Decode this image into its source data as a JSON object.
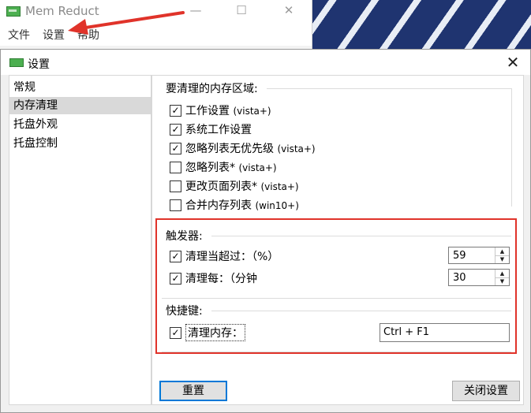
{
  "main_window": {
    "title": "Mem Reduct",
    "controls": {
      "minimize": "—",
      "maximize": "☐",
      "close": "✕"
    },
    "menu": [
      "文件",
      "设置",
      "帮助"
    ]
  },
  "dialog": {
    "title": "设置",
    "close": "✕",
    "nav": [
      "常规",
      "内存清理",
      "托盘外观",
      "托盘控制"
    ],
    "selected_nav": "内存清理",
    "regions": {
      "title": "要清理的内存区域:",
      "items": [
        {
          "label": "工作设置",
          "suffix": "(vista+)",
          "checked": true
        },
        {
          "label": "系统工作设置",
          "suffix": "",
          "checked": true
        },
        {
          "label": "忽略列表无优先级",
          "suffix": "(vista+)",
          "checked": true
        },
        {
          "label": "忽略列表*",
          "suffix": "(vista+)",
          "checked": false
        },
        {
          "label": "更改页面列表*",
          "suffix": "(vista+)",
          "checked": false
        },
        {
          "label": "合并内存列表",
          "suffix": "(win10+)",
          "checked": false
        }
      ]
    },
    "triggers": {
      "title": "触发器:",
      "threshold": {
        "label": "清理当超过：（%）",
        "checked": true,
        "value": "59"
      },
      "interval": {
        "label": "清理每：（分钟",
        "checked": true,
        "value": "30"
      }
    },
    "hotkeys": {
      "title": "快捷键:",
      "clean": {
        "label": "清理内存：",
        "checked": true,
        "value": "Ctrl + F1"
      }
    },
    "buttons": {
      "reset": "重置",
      "close": "关闭设置"
    }
  },
  "colors": {
    "highlight_box": "#e0332a",
    "arrow": "#e0332a",
    "primary_button_border": "#0078d7",
    "selection": "#d9d9d9"
  }
}
